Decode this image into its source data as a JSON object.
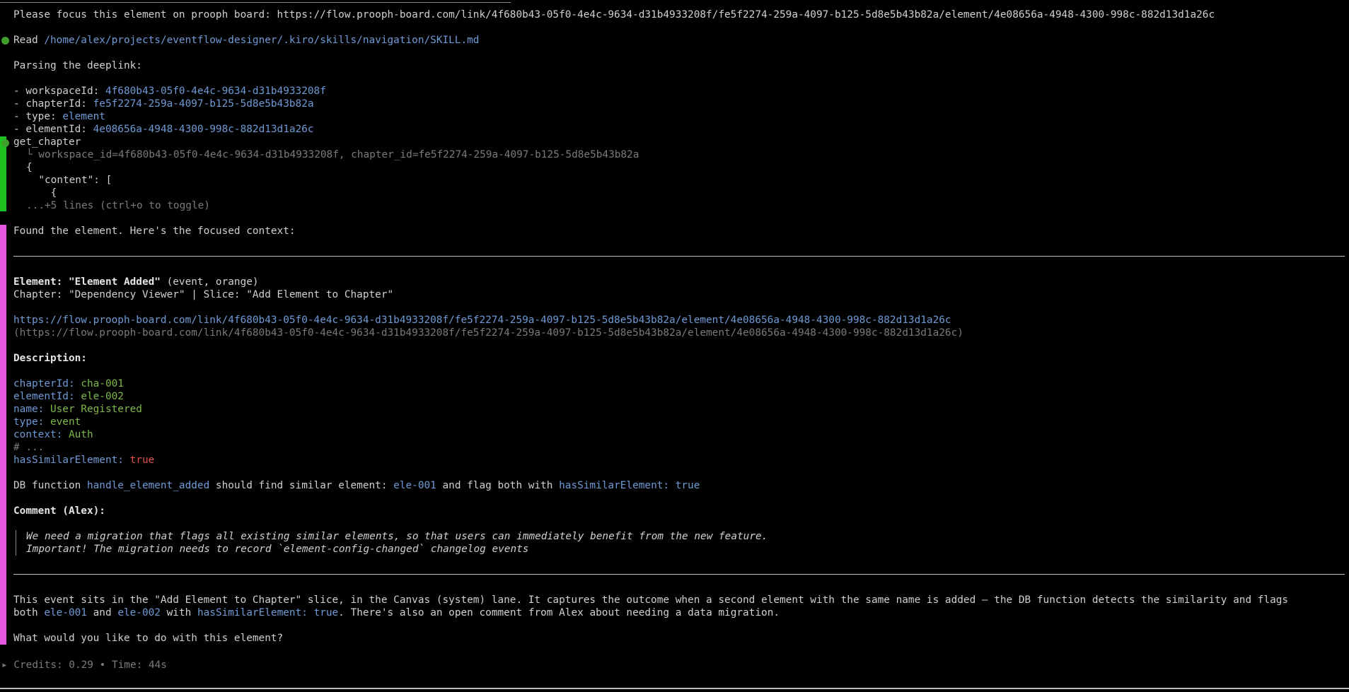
{
  "prompt": {
    "text": "Please focus this element on prooph board: https://flow.prooph-board.com/link/4f680b43-05f0-4e4c-9634-d31b4933208f/fe5f2274-259a-4097-b125-5d8e5b43b82a/element/4e08656a-4948-4300-998c-882d13d1a26c"
  },
  "read_tool": {
    "label": "Read ",
    "path": "/home/alex/projects/eventflow-designer/.kiro/skills/navigation/SKILL.md"
  },
  "parsing": {
    "heading": "Parsing the deeplink:",
    "items": [
      {
        "key": "- workspaceId: ",
        "value": "4f680b43-05f0-4e4c-9634-d31b4933208f"
      },
      {
        "key": "- chapterId: ",
        "value": "fe5f2274-259a-4097-b125-5d8e5b43b82a"
      },
      {
        "key": "- type: ",
        "value": "element"
      },
      {
        "key": "- elementId: ",
        "value": "4e08656a-4948-4300-998c-882d13d1a26c"
      }
    ]
  },
  "tool_call": {
    "name": "get_chapter",
    "args": "└ workspace_id=4f680b43-05f0-4e4c-9634-d31b4933208f, chapter_id=fe5f2274-259a-4097-b125-5d8e5b43b82a",
    "output_lines": [
      "{",
      "  \"content\": [",
      "    {"
    ],
    "toggle_hint": "...+5 lines (ctrl+o to toggle)"
  },
  "response": {
    "intro": "Found the element. Here's the focused context:",
    "element_label": "Element: \"Element Added\"",
    "element_meta": " (event, orange)",
    "chapter_line": "Chapter: \"Dependency Viewer\" | Slice: \"Add Element to Chapter\"",
    "link": "https://flow.prooph-board.com/link/4f680b43-05f0-4e4c-9634-d31b4933208f/fe5f2274-259a-4097-b125-5d8e5b43b82a/element/4e08656a-4948-4300-998c-882d13d1a26c",
    "link_paren": "(https://flow.prooph-board.com/link/4f680b43-05f0-4e4c-9634-d31b4933208f/fe5f2274-259a-4097-b125-5d8e5b43b82a/element/4e08656a-4948-4300-998c-882d13d1a26c)",
    "description_heading": "Description:",
    "yaml": [
      {
        "key": "chapterId: ",
        "value": "cha-001"
      },
      {
        "key": "elementId: ",
        "value": "ele-002"
      },
      {
        "key": "name: ",
        "value": "User Registered"
      },
      {
        "key": "type: ",
        "value": "event"
      },
      {
        "key": "context: ",
        "value": "Auth"
      }
    ],
    "yaml_comment": "# ...",
    "yaml_flag_key": "hasSimilarElement: ",
    "yaml_flag_value": "true",
    "db_line": {
      "t1": "DB function ",
      "fn": "handle_element_added",
      "t2": " should find similar element: ",
      "el": "ele-001",
      "t3": " and flag both with ",
      "flag": "hasSimilarElement: true"
    },
    "comment_heading": "Comment (Alex):",
    "comment_lines": [
      "We need a migration that flags all existing similar elements, so that users can immediately benefit from the new feature.",
      "Important! The migration needs to record `element-config-changed` changelog events"
    ],
    "summary1": "This event sits in the \"Add Element to Chapter\" slice, in the Canvas (system) lane. It captures the outcome when a second element with the same name is added — the DB function detects the similarity and flags",
    "summary2": {
      "t1": "both ",
      "e1": "ele-001",
      "t2": " and ",
      "e2": "ele-002",
      "t3": " with ",
      "flag": "hasSimilarElement: true",
      "t4": ". There's also an open comment from Alex about needing a data migration."
    },
    "question": "What would you like to do with this element?"
  },
  "footer": {
    "arrow": "▸",
    "text": " Credits: 0.29 • Time: 44s"
  }
}
